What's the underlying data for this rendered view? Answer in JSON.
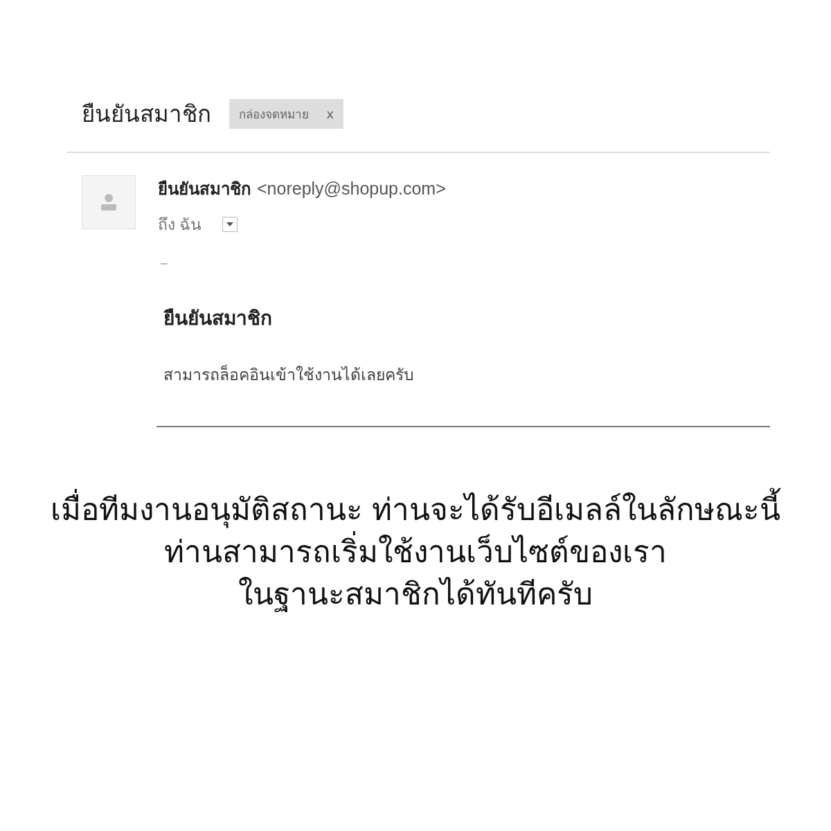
{
  "email": {
    "subject": "ยืนยันสมาชิก",
    "label": {
      "text": "กล่องจดหมาย",
      "close": "x"
    },
    "sender": {
      "name": "ยืนยันสมาชิก",
      "address": "<noreply@shopup.com>"
    },
    "recipient": "ถึง ฉัน",
    "body": {
      "heading": "ยืนยันสมาชิก",
      "message": "สามารถล็อคอินเข้าใช้งานได้เลยครับ"
    }
  },
  "caption": [
    "เมื่อทีมงานอนุมัติสถานะ ท่านจะได้รับอีเมลล์ในลักษณะนี้",
    "ท่านสามารถเริ่มใช้งานเว็บไซต์ของเรา",
    "ในฐานะสมาชิกได้ทันทีครับ"
  ]
}
